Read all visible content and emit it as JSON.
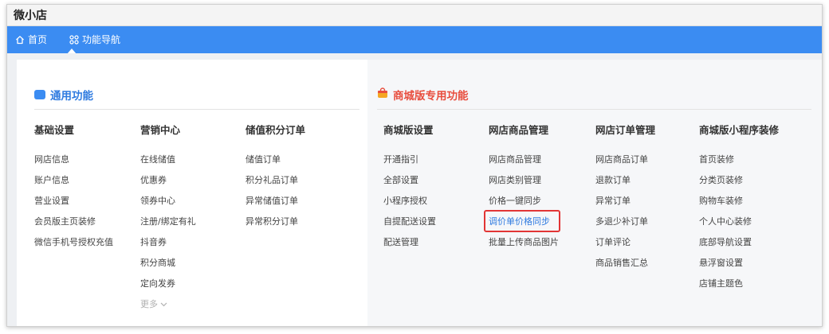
{
  "app": {
    "title": "微小店"
  },
  "nav": {
    "items": [
      {
        "label": "首页",
        "icon": "home-icon"
      },
      {
        "label": "功能导航",
        "icon": "grid-icon"
      }
    ],
    "bg_color": "#3b8cf2"
  },
  "sections": {
    "general": {
      "title": "通用功能",
      "accent": "#3b8cf2",
      "columns": [
        {
          "title": "基础设置",
          "items": [
            "网店信息",
            "账户信息",
            "营业设置",
            "会员版主页装修",
            "微信手机号授权充值"
          ]
        },
        {
          "title": "营销中心",
          "items": [
            "在线储值",
            "优惠券",
            "领券中心",
            "注册/绑定有礼",
            "抖音券",
            "积分商城",
            "定向发券"
          ],
          "more": "更多"
        },
        {
          "title": "储值积分订单",
          "items": [
            "储值订单",
            "积分礼品订单",
            "异常储值订单",
            "异常积分订单"
          ]
        }
      ]
    },
    "mall": {
      "title": "商城版专用功能",
      "accent": "#e84d3d",
      "columns": [
        {
          "title": "商城版设置",
          "items": [
            "开通指引",
            "全部设置",
            "小程序授权",
            "自提配送设置",
            "配送管理"
          ]
        },
        {
          "title": "网店商品管理",
          "items": [
            "网店商品管理",
            "网店类别管理",
            "价格一键同步",
            "调价单价格同步",
            "批量上传商品图片"
          ],
          "highlighted": "调价单价格同步"
        },
        {
          "title": "网店订单管理",
          "items": [
            "网店商品订单",
            "退款订单",
            "异常订单",
            "多退少补订单",
            "订单评论",
            "商品销售汇总"
          ]
        },
        {
          "title": "商城版小程序装修",
          "items": [
            "首页装修",
            "分类页装修",
            "购物车装修",
            "个人中心装修",
            "底部导航设置",
            "悬浮窗设置",
            "店铺主题色"
          ]
        }
      ]
    }
  }
}
